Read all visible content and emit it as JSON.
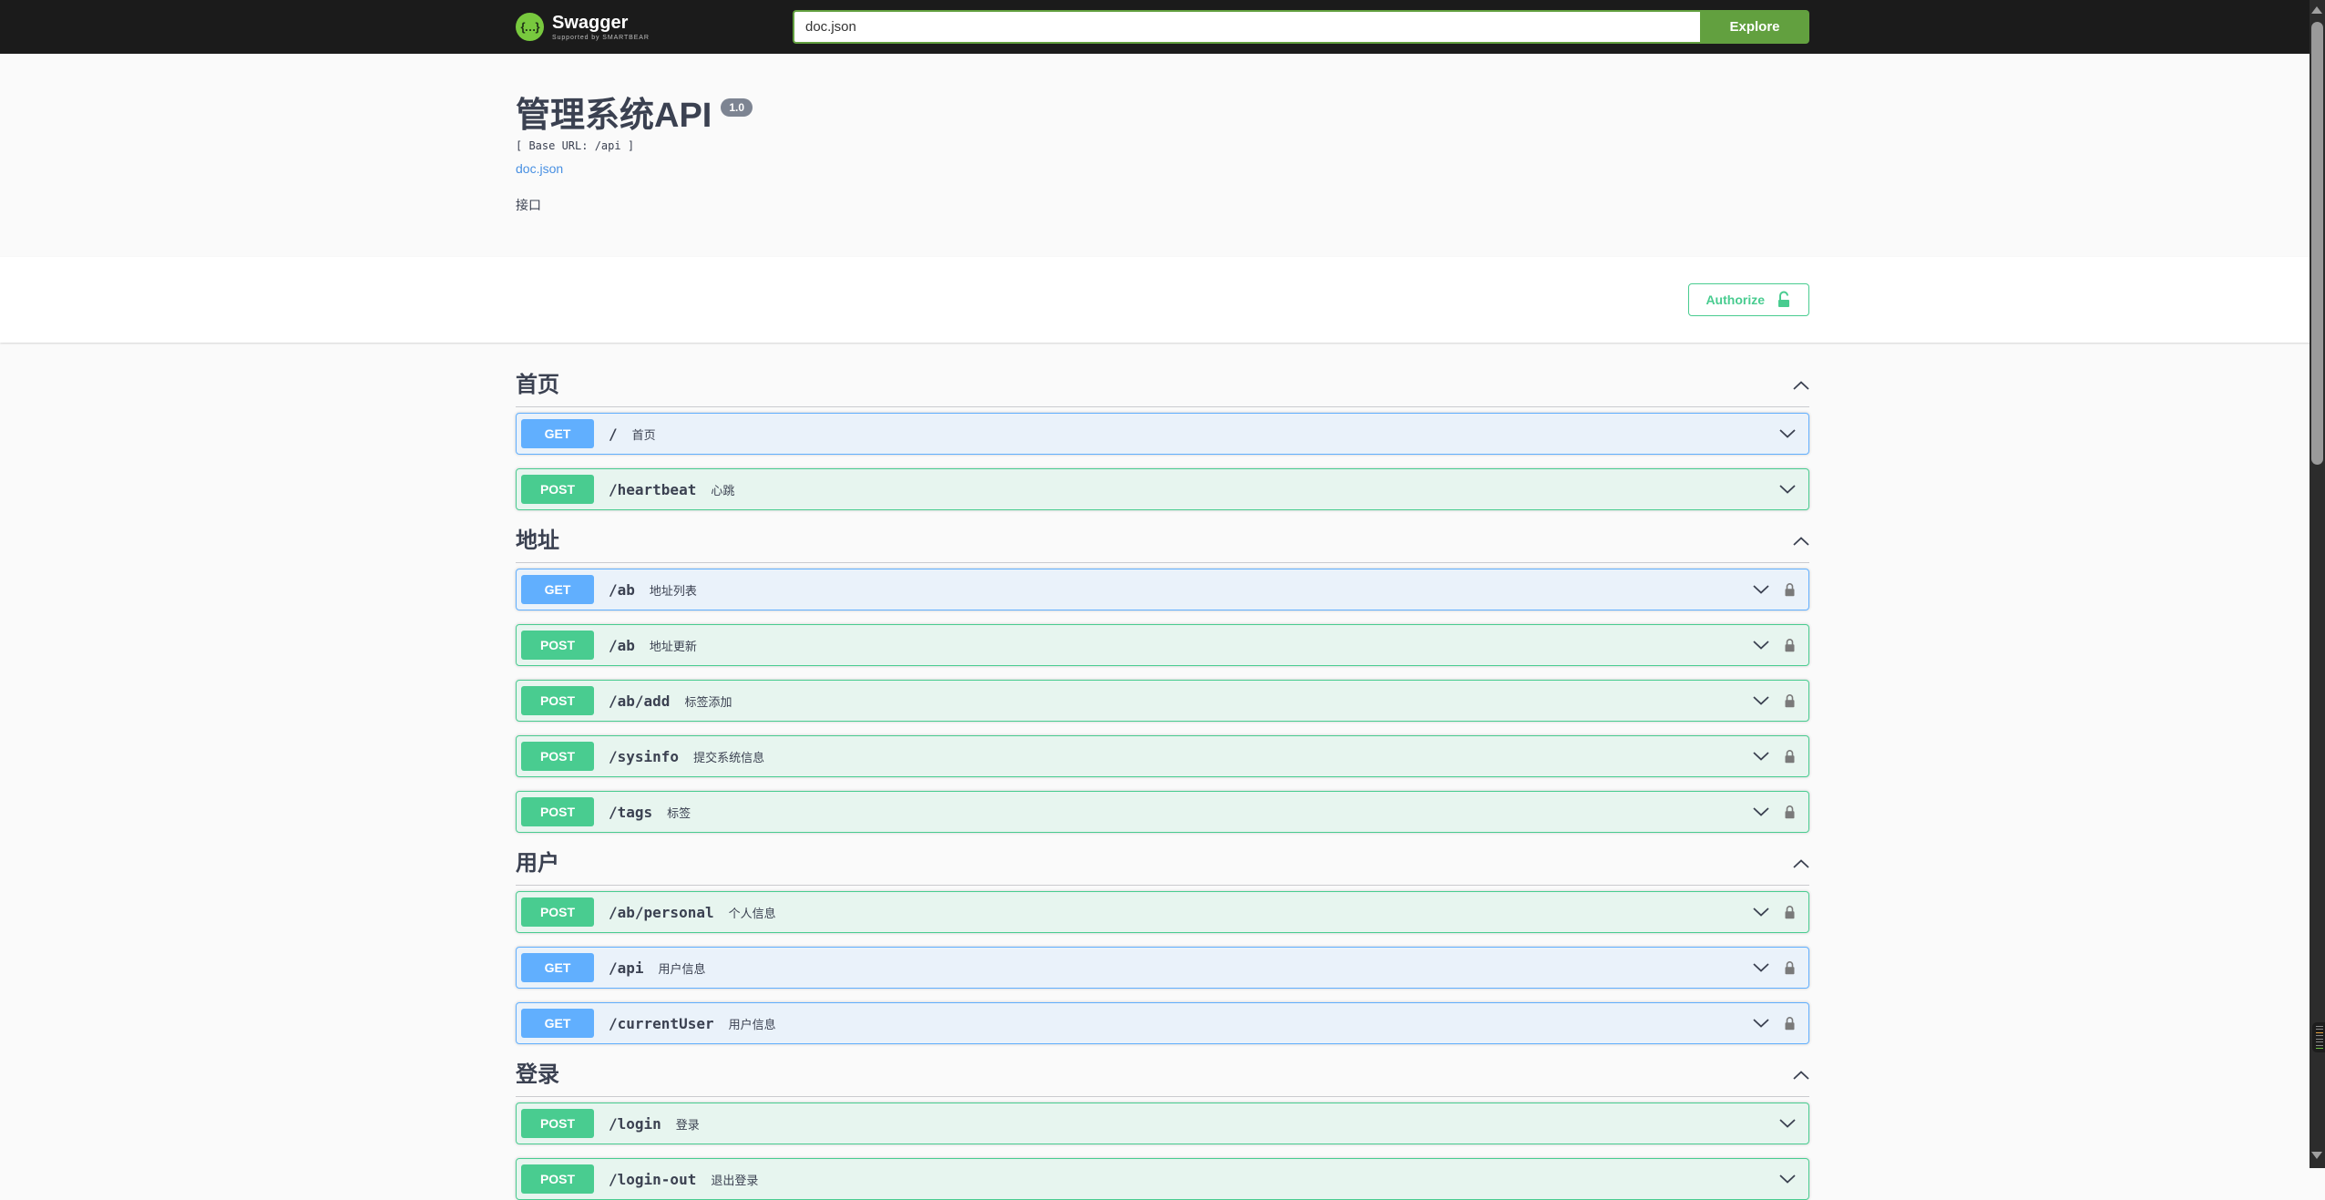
{
  "topbar": {
    "brand": "Swagger",
    "brand_tagline": "Supported by SMARTBEAR",
    "logo_glyph": "{…}",
    "search_value": "doc.json",
    "explore_label": "Explore"
  },
  "info": {
    "title": "管理系统API",
    "version_badge": "1.0",
    "base_url": "[ Base URL: /api ]",
    "spec_link": "doc.json",
    "description": "接口"
  },
  "auth": {
    "authorize_label": "Authorize"
  },
  "method_colors": {
    "GET": "#61affe",
    "POST": "#49cc90"
  },
  "sections": [
    {
      "title": "首页",
      "expanded": true,
      "endpoints": [
        {
          "method": "GET",
          "path": "/",
          "summary": "首页",
          "locked": false
        },
        {
          "method": "POST",
          "path": "/heartbeat",
          "summary": "心跳",
          "locked": false
        }
      ]
    },
    {
      "title": "地址",
      "expanded": true,
      "endpoints": [
        {
          "method": "GET",
          "path": "/ab",
          "summary": "地址列表",
          "locked": true
        },
        {
          "method": "POST",
          "path": "/ab",
          "summary": "地址更新",
          "locked": true
        },
        {
          "method": "POST",
          "path": "/ab/add",
          "summary": "标签添加",
          "locked": true
        },
        {
          "method": "POST",
          "path": "/sysinfo",
          "summary": "提交系统信息",
          "locked": true
        },
        {
          "method": "POST",
          "path": "/tags",
          "summary": "标签",
          "locked": true
        }
      ]
    },
    {
      "title": "用户",
      "expanded": true,
      "endpoints": [
        {
          "method": "POST",
          "path": "/ab/personal",
          "summary": "个人信息",
          "locked": true
        },
        {
          "method": "GET",
          "path": "/api",
          "summary": "用户信息",
          "locked": true
        },
        {
          "method": "GET",
          "path": "/currentUser",
          "summary": "用户信息",
          "locked": true
        }
      ]
    },
    {
      "title": "登录",
      "expanded": true,
      "endpoints": [
        {
          "method": "POST",
          "path": "/login",
          "summary": "登录",
          "locked": false
        },
        {
          "method": "POST",
          "path": "/login-out",
          "summary": "退出登录",
          "locked": false
        }
      ]
    }
  ],
  "scrollbar": {
    "minimap_marks": [
      "#8a8a8a",
      "#8a8a8a",
      "#e8a33d",
      "#8a8a8a",
      "#8a8a8a",
      "#8a8a8a",
      "#8a8a8a",
      "#6abf40"
    ]
  }
}
